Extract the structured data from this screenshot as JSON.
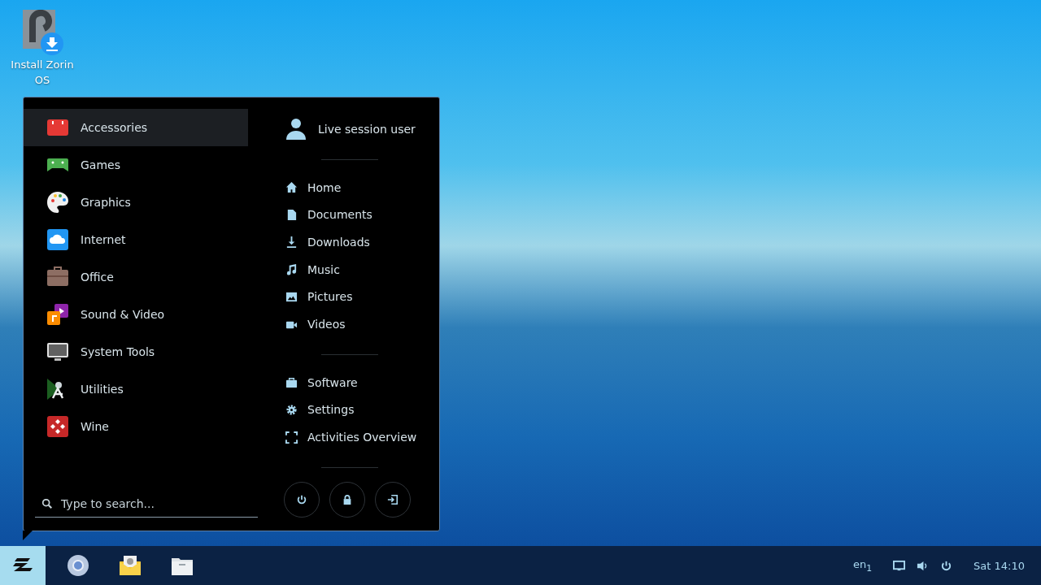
{
  "desktop_icons": [
    {
      "label": "Install Zorin OS",
      "kind": "installer"
    }
  ],
  "menu": {
    "categories": [
      {
        "label": "Accessories",
        "kind": "accessories",
        "selected": true
      },
      {
        "label": "Games",
        "kind": "games",
        "selected": false
      },
      {
        "label": "Graphics",
        "kind": "graphics",
        "selected": false
      },
      {
        "label": "Internet",
        "kind": "internet",
        "selected": false
      },
      {
        "label": "Office",
        "kind": "office",
        "selected": false
      },
      {
        "label": "Sound & Video",
        "kind": "media",
        "selected": false
      },
      {
        "label": "System Tools",
        "kind": "system",
        "selected": false
      },
      {
        "label": "Utilities",
        "kind": "utilities",
        "selected": false
      },
      {
        "label": "Wine",
        "kind": "wine",
        "selected": false
      }
    ],
    "search": {
      "placeholder": "Type to search..."
    },
    "user": "Live session user",
    "places": [
      {
        "label": "Home",
        "kind": "home"
      },
      {
        "label": "Documents",
        "kind": "document"
      },
      {
        "label": "Downloads",
        "kind": "download"
      },
      {
        "label": "Music",
        "kind": "music"
      },
      {
        "label": "Pictures",
        "kind": "picture"
      },
      {
        "label": "Videos",
        "kind": "video"
      }
    ],
    "system": [
      {
        "label": "Software",
        "kind": "software"
      },
      {
        "label": "Settings",
        "kind": "settings"
      },
      {
        "label": "Activities Overview",
        "kind": "overview"
      }
    ],
    "power_buttons": [
      {
        "kind": "power"
      },
      {
        "kind": "lock"
      },
      {
        "kind": "logout"
      }
    ]
  },
  "taskbar": {
    "apps": [
      {
        "kind": "start",
        "selected": true
      },
      {
        "kind": "browser",
        "selected": false
      },
      {
        "kind": "mail",
        "selected": false
      },
      {
        "kind": "files",
        "selected": false
      }
    ],
    "language": "en$_{1}$",
    "tray": [
      {
        "kind": "display"
      },
      {
        "kind": "volume"
      },
      {
        "kind": "power"
      }
    ],
    "clock": "Sat 14:10"
  }
}
